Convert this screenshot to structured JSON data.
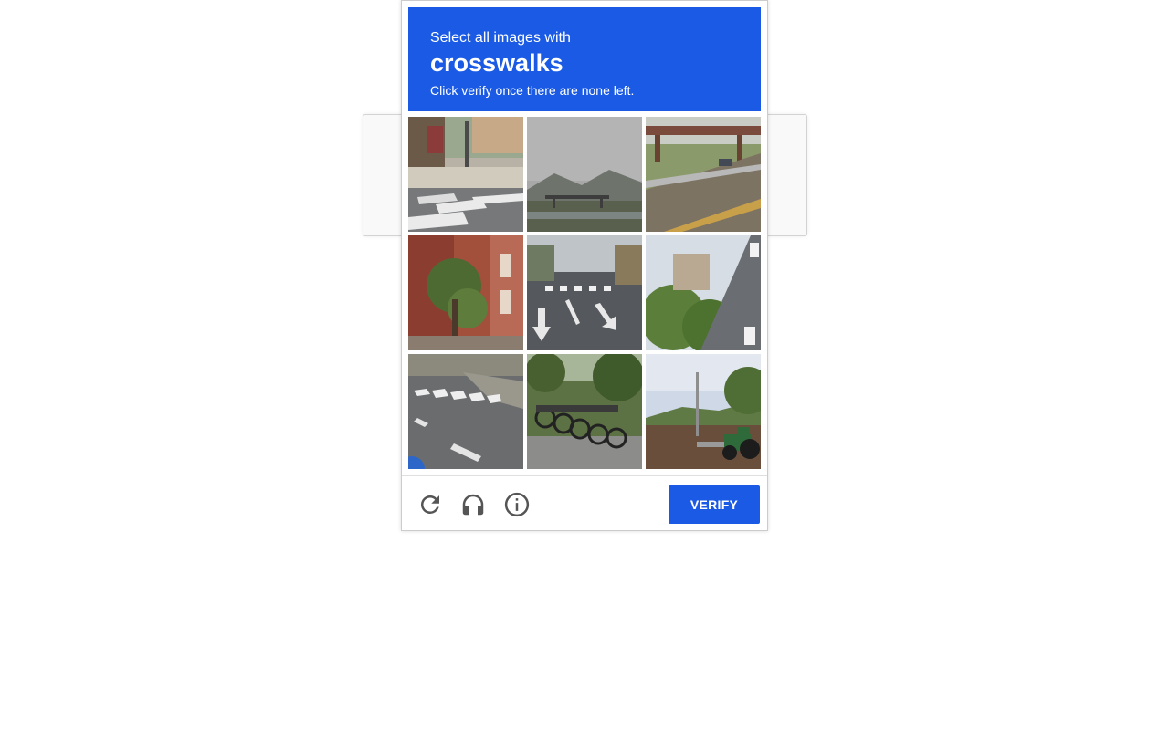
{
  "challenge": {
    "instruction_prefix": "Select all images with",
    "keyword": "crosswalks",
    "instruction_suffix": "Click verify once there are none left.",
    "header_color": "#1a5ae4"
  },
  "tiles": [
    {
      "subject": "street corner with crosswalk and pedestrians"
    },
    {
      "subject": "cloudy mountains with bridge over river"
    },
    {
      "subject": "overpass bridge above railway"
    },
    {
      "subject": "red brick building with tree"
    },
    {
      "subject": "road with arrows and crosswalk"
    },
    {
      "subject": "grey house siding with trees"
    },
    {
      "subject": "curving street with crosswalk"
    },
    {
      "subject": "parked bicycles under trees"
    },
    {
      "subject": "tractor in plowed field"
    }
  ],
  "footer": {
    "reload_icon": "reload-icon",
    "audio_icon": "headphones-icon",
    "info_icon": "info-icon",
    "verify_label": "VERIFY"
  }
}
